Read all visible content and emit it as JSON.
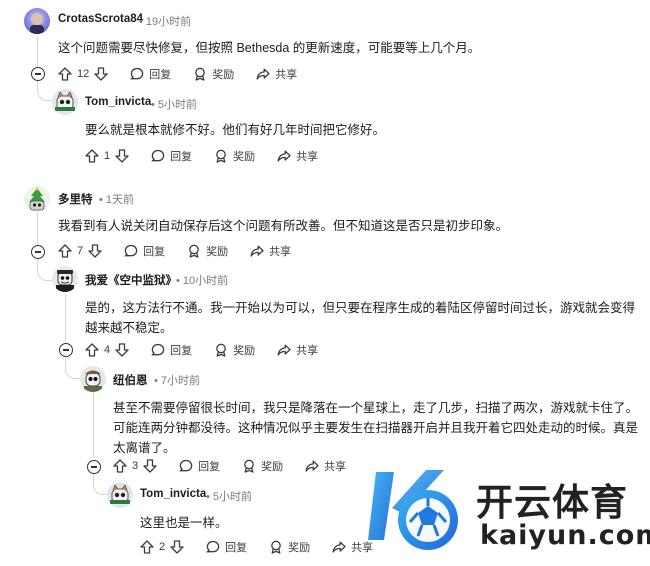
{
  "comments": [
    {
      "user": "CrotasScrota84",
      "time": "19小时前",
      "body": "这个问题需要尽快修复，但按照 Bethesda 的更新速度，可能要等上几个月。",
      "votes": "12",
      "reply": "回复",
      "award": "奖励",
      "share": "共享"
    },
    {
      "user": "Tom_invicta",
      "time": "5小时前",
      "body": "要么就是根本就修不好。他们有好几年时间把它修好。",
      "votes": "1",
      "reply": "回复",
      "award": "奖励",
      "share": "共享"
    },
    {
      "user": "多里特",
      "time": "1天前",
      "body": "我看到有人说关闭自动保存后这个问题有所改善。但不知道这是否只是初步印象。",
      "votes": "7",
      "reply": "回复",
      "award": "奖励",
      "share": "共享"
    },
    {
      "user": "我爱《空中监狱》",
      "time": "10小时前",
      "body": "是的，这方法行不通。我一开始以为可以，但只要在程序生成的着陆区停留时间过长，游戏就会变得越来越不稳定。",
      "votes": "4",
      "reply": "回复",
      "award": "奖励",
      "share": "共享"
    },
    {
      "user": "纽伯恩",
      "time": "7小时前",
      "body": "甚至不需要停留很长时间，我只是降落在一个星球上，走了几步，扫描了两次，游戏就卡住了。可能连两分钟都没待。这种情况似乎主要发生在扫描器开启并且我开着它四处走动的时候。真是太离谱了。",
      "votes": "3",
      "reply": "回复",
      "award": "奖励",
      "share": "共享"
    },
    {
      "user": "Tom_invicta",
      "time": "5小时前",
      "body": "这里也是一样。",
      "votes": "2",
      "reply": "回复",
      "award": "奖励",
      "share": "共享"
    }
  ],
  "watermark": {
    "brand": "开云体育",
    "domain": "kaiyun.com"
  },
  "colors": {
    "accent": "#1f7be0",
    "muted": "#7c7c7c",
    "thread_line": "#d6d6d6"
  }
}
